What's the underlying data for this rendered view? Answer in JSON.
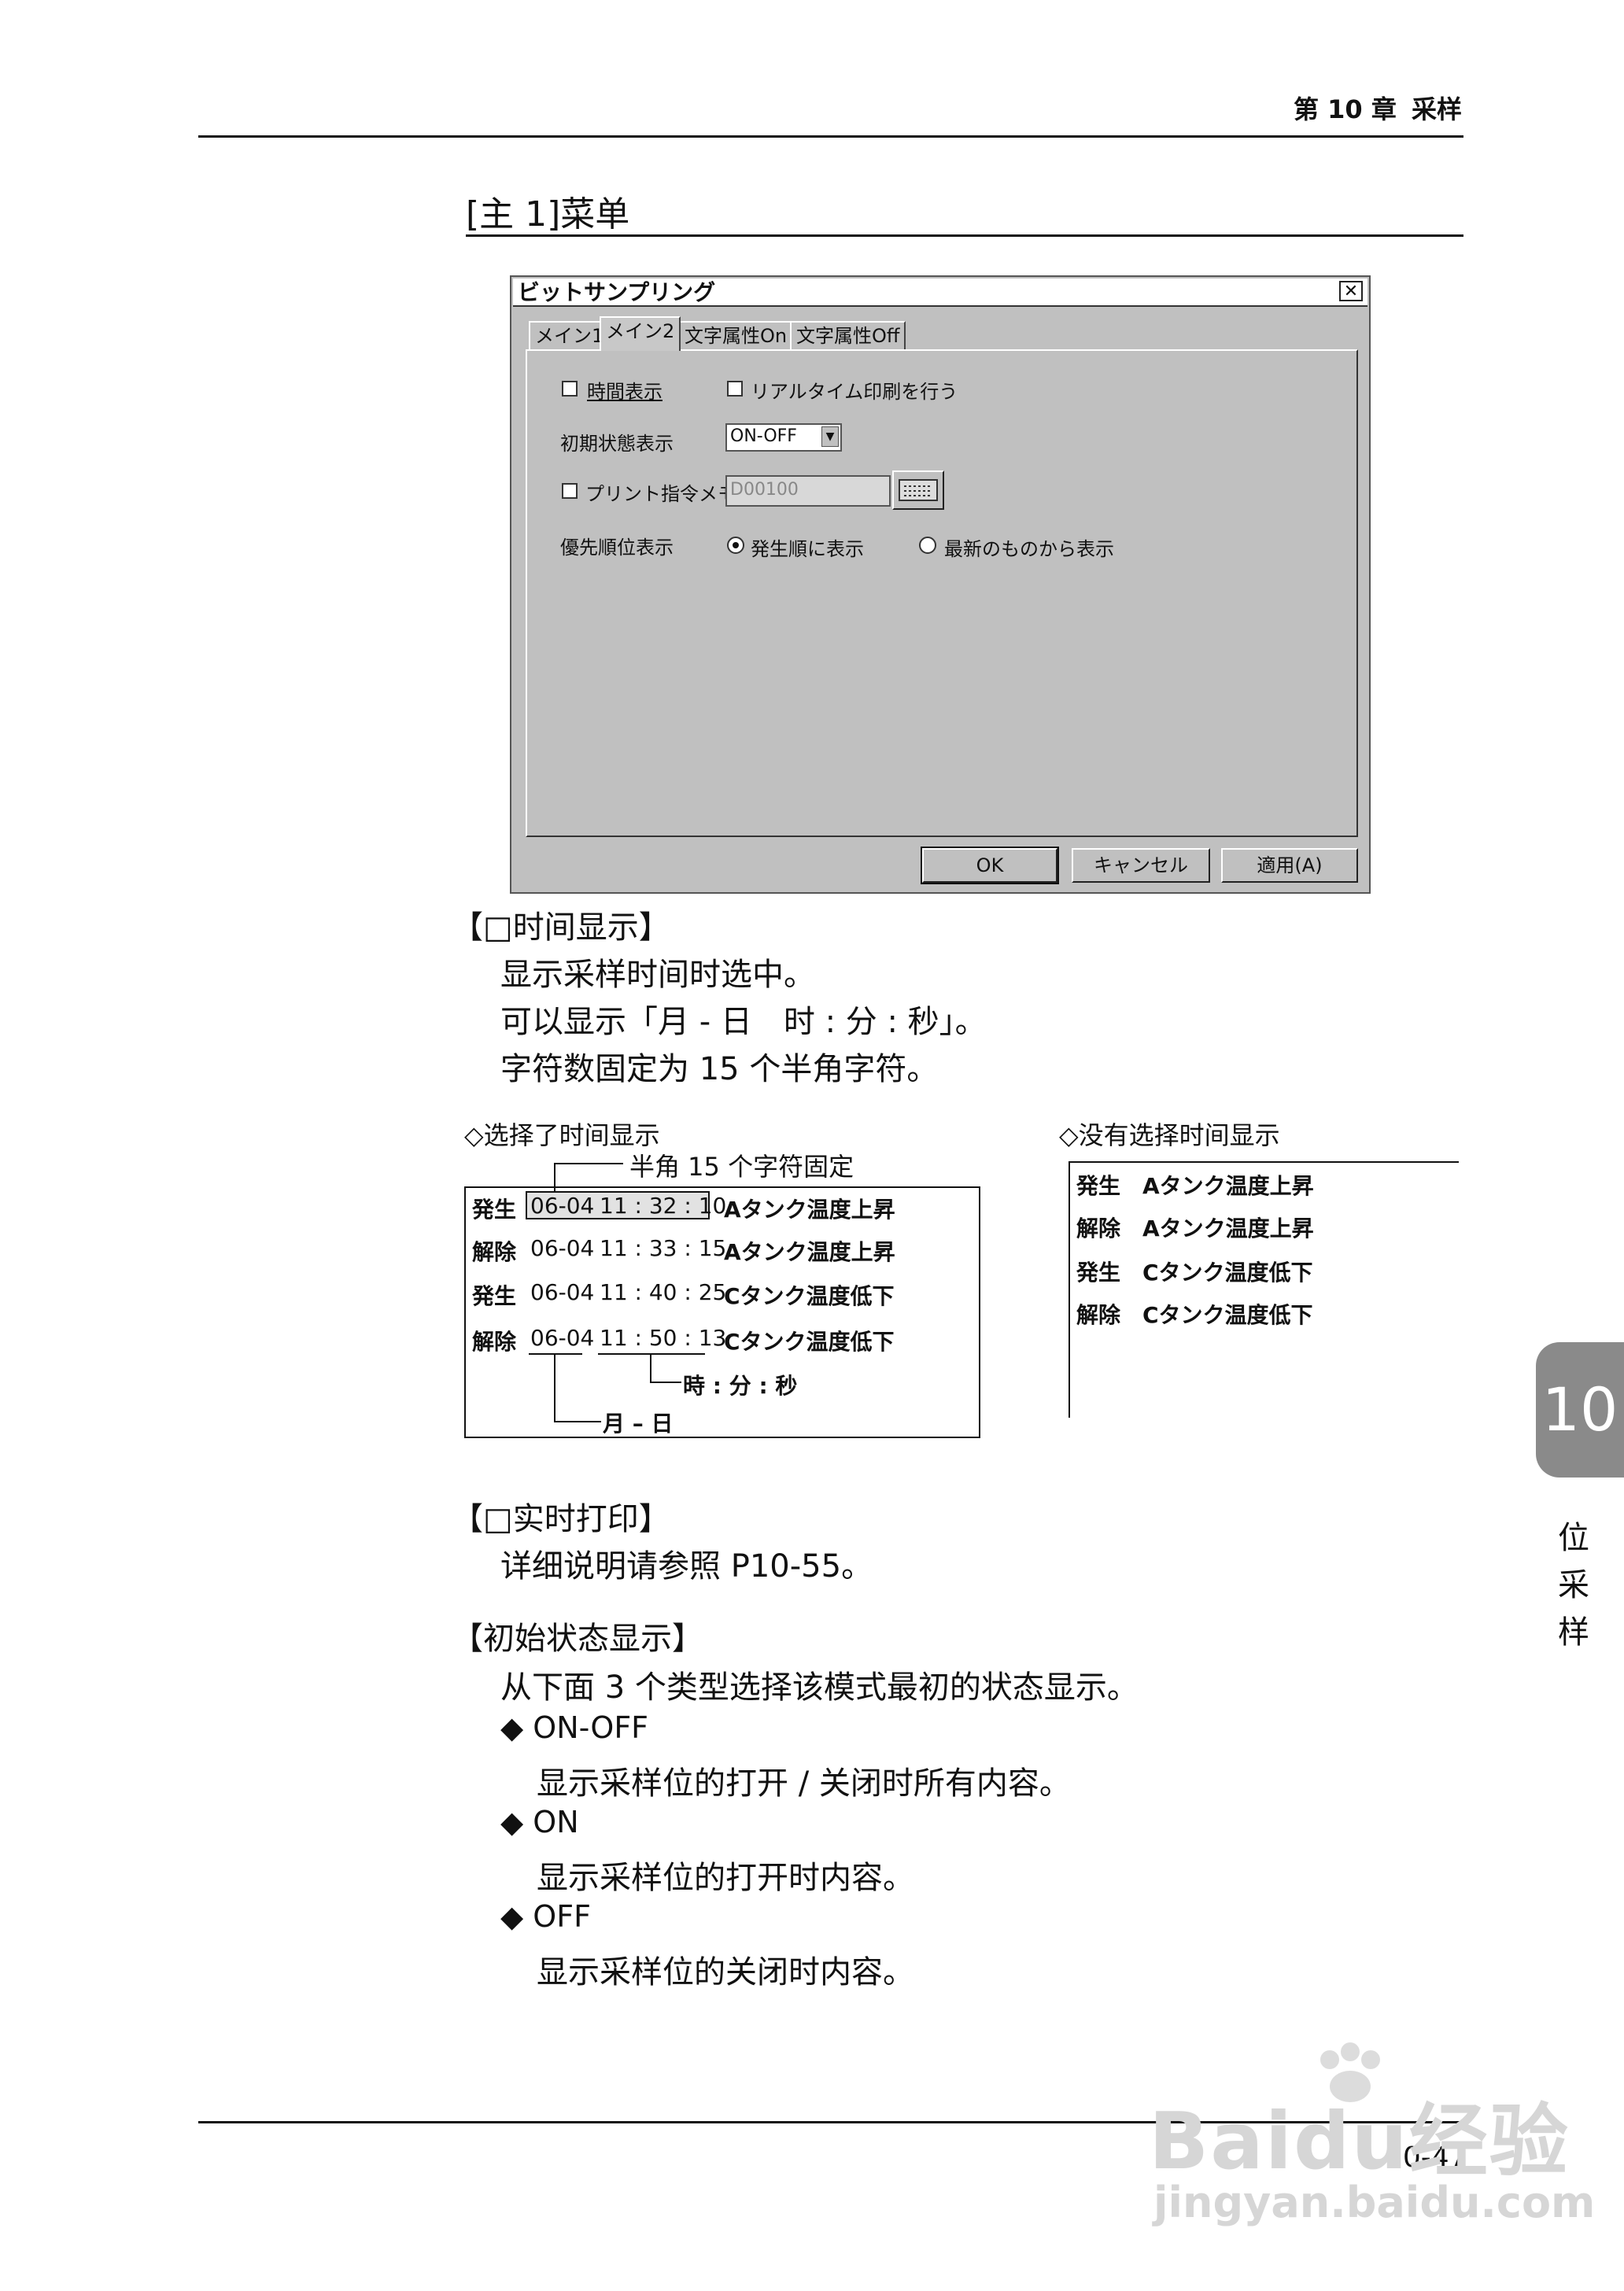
{
  "header": {
    "chapter": "第 10 章",
    "title": "采样"
  },
  "section_title": "[主 1]菜单",
  "dialog": {
    "title": "ビットサンプリング",
    "close": "✕",
    "tabs": [
      "メイン1",
      "メイン2",
      "文字属性On",
      "文字属性Off"
    ],
    "time_display_label": "時間表示",
    "realtime_print_label": "リアルタイム印刷を行う",
    "initial_state_label": "初期状態表示",
    "initial_state_value": "ON-OFF",
    "print_memory_label": "プリント指令メモリ",
    "print_memory_value": "D00100",
    "priority_label": "優先順位表示",
    "radio_occurrence": "発生順に表示",
    "radio_newest": "最新のものから表示",
    "buttons": {
      "ok": "OK",
      "cancel": "キャンセル",
      "apply": "適用(A)"
    }
  },
  "time_section": {
    "heading": "【□时间显示】",
    "lines": [
      "显示采样时间时选中。",
      "可以显示「月 - 日　时 : 分 : 秒」。",
      "字符数固定为 15 个半角字符。"
    ]
  },
  "example_selected": {
    "caption": "◇选择了时间显示",
    "note_top": "半角 15 个字符固定",
    "rows": [
      {
        "status": "発生",
        "date": "06-04",
        "time": "11 : 32 : 10",
        "msg": "Aタンク温度上昇"
      },
      {
        "status": "解除",
        "date": "06-04",
        "time": "11 : 33 : 15",
        "msg": "Aタンク温度上昇"
      },
      {
        "status": "発生",
        "date": "06-04",
        "time": "11 : 40 : 25",
        "msg": "Cタンク温度低下"
      },
      {
        "status": "解除",
        "date": "06-04",
        "time": "11 : 50 : 13",
        "msg": "Cタンク温度低下"
      }
    ],
    "note_time": "時 : 分 : 秒",
    "note_date": "月 – 日"
  },
  "example_unselected": {
    "caption": "◇没有选择时间显示",
    "rows": [
      {
        "status": "発生",
        "msg": "Aタンク温度上昇"
      },
      {
        "status": "解除",
        "msg": "Aタンク温度上昇"
      },
      {
        "status": "発生",
        "msg": "Cタンク温度低下"
      },
      {
        "status": "解除",
        "msg": "Cタンク温度低下"
      }
    ]
  },
  "realtime_section": {
    "heading": "【□实时打印】",
    "line": "详细说明请参照 P10-55。"
  },
  "initial_section": {
    "heading": "【初始状态显示】",
    "intro": "从下面 3 个类型选择该模式最初的状态显示。",
    "items": [
      {
        "bullet": "◆ ON-OFF",
        "desc": "显示采样位的打开 / 关闭时所有内容。"
      },
      {
        "bullet": "◆ ON",
        "desc": "显示采样位的打开时内容。"
      },
      {
        "bullet": "◆ OFF",
        "desc": "显示采样位的关闭时内容。"
      }
    ]
  },
  "side_tab": {
    "number": "10",
    "chars": [
      "位",
      "采",
      "样"
    ]
  },
  "page_number": "10-47",
  "watermark": {
    "brand": "Baidu经验",
    "url": "jingyan.baidu.com"
  }
}
